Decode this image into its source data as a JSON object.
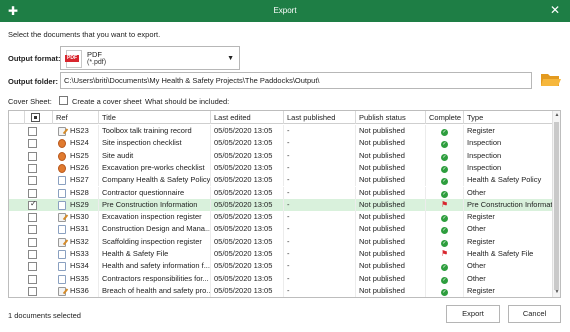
{
  "window": {
    "title": "Export",
    "app_icon": "plus-icon",
    "close_icon": "close-icon"
  },
  "instructions": "Select the documents that you want to export.",
  "output_format": {
    "label": "Output format:",
    "name": "PDF",
    "extension": "(*.pdf)",
    "icon": "pdf-file-icon",
    "icon_text": "PDF"
  },
  "output_folder": {
    "label": "Output folder:",
    "path": "C:\\Users\\briti\\Documents\\My Health & Safety Projects\\The Paddocks\\Output\\"
  },
  "cover_sheet": {
    "label": "Cover Sheet:",
    "checkbox_label": "Create a cover sheet",
    "include_label": "What should be included:"
  },
  "table": {
    "columns": [
      "Ref",
      "Title",
      "Last edited",
      "Last published",
      "Publish status",
      "Complete",
      "Type"
    ],
    "rows": [
      {
        "icon": "reg",
        "ref": "HS23",
        "title": "Toolbox talk training record",
        "edited": "05/05/2020 13:05",
        "published": "-",
        "status": "Not published",
        "complete": "ok",
        "type": "Register",
        "checked": false
      },
      {
        "icon": "insp",
        "ref": "HS24",
        "title": "Site inspection checklist",
        "edited": "05/05/2020 13:05",
        "published": "-",
        "status": "Not published",
        "complete": "ok",
        "type": "Inspection",
        "checked": false
      },
      {
        "icon": "insp",
        "ref": "HS25",
        "title": "Site audit",
        "edited": "05/05/2020 13:05",
        "published": "-",
        "status": "Not published",
        "complete": "ok",
        "type": "Inspection",
        "checked": false
      },
      {
        "icon": "insp",
        "ref": "HS26",
        "title": "Excavation pre-works checklist",
        "edited": "05/05/2020 13:05",
        "published": "-",
        "status": "Not published",
        "complete": "ok",
        "type": "Inspection",
        "checked": false
      },
      {
        "icon": "hs",
        "ref": "HS27",
        "title": "Company Health & Safety Policy",
        "edited": "05/05/2020 13:05",
        "published": "-",
        "status": "Not published",
        "complete": "ok",
        "type": "Health & Safety Policy",
        "checked": false
      },
      {
        "icon": "oth",
        "ref": "HS28",
        "title": "Contractor questionnaire",
        "edited": "05/05/2020 13:05",
        "published": "-",
        "status": "Not published",
        "complete": "ok",
        "type": "Other",
        "checked": false
      },
      {
        "icon": "oth",
        "ref": "HS29",
        "title": "Pre Construction Information",
        "edited": "05/05/2020 13:05",
        "published": "-",
        "status": "Not published",
        "complete": "flag",
        "type": "Pre Construction Informatio",
        "checked": true,
        "selected": true
      },
      {
        "icon": "reg",
        "ref": "HS30",
        "title": "Excavation inspection register",
        "edited": "05/05/2020 13:05",
        "published": "-",
        "status": "Not published",
        "complete": "ok",
        "type": "Register",
        "checked": false
      },
      {
        "icon": "oth",
        "ref": "HS31",
        "title": "Construction Design and Mana...",
        "edited": "05/05/2020 13:05",
        "published": "-",
        "status": "Not published",
        "complete": "ok",
        "type": "Other",
        "checked": false
      },
      {
        "icon": "reg",
        "ref": "HS32",
        "title": "Scaffolding inspection register",
        "edited": "05/05/2020 13:05",
        "published": "-",
        "status": "Not published",
        "complete": "ok",
        "type": "Register",
        "checked": false
      },
      {
        "icon": "hs",
        "ref": "HS33",
        "title": "Health & Safety File",
        "edited": "05/05/2020 13:05",
        "published": "-",
        "status": "Not published",
        "complete": "flag",
        "type": "Health & Safety File",
        "checked": false
      },
      {
        "icon": "oth",
        "ref": "HS34",
        "title": "Health and safety information f...",
        "edited": "05/05/2020 13:05",
        "published": "-",
        "status": "Not published",
        "complete": "ok",
        "type": "Other",
        "checked": false
      },
      {
        "icon": "oth",
        "ref": "HS35",
        "title": "Contractors responsibilities for...",
        "edited": "05/05/2020 13:05",
        "published": "-",
        "status": "Not published",
        "complete": "ok",
        "type": "Other",
        "checked": false
      },
      {
        "icon": "reg",
        "ref": "HS36",
        "title": "Breach of health and safety pro...",
        "edited": "05/05/2020 13:05",
        "published": "-",
        "status": "Not published",
        "complete": "ok",
        "type": "Register",
        "checked": false
      }
    ]
  },
  "status_text": "1 documents selected",
  "buttons": {
    "export": "Export",
    "cancel": "Cancel"
  },
  "colors": {
    "titlebar": "#1e7e45",
    "selected_row": "#d9f1dc",
    "ok": "#2e9e3e",
    "flag": "#d8262e",
    "folder": "#f0a830"
  }
}
